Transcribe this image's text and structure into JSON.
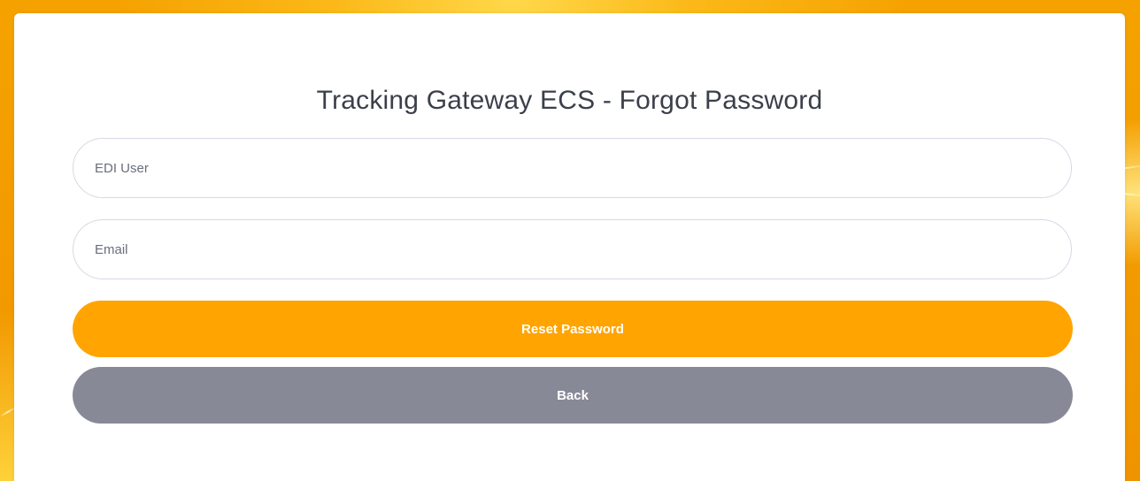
{
  "page": {
    "title": "Tracking Gateway ECS - Forgot Password"
  },
  "form": {
    "edi_user": {
      "value": "",
      "placeholder": "EDI User"
    },
    "email": {
      "value": "",
      "placeholder": "Email"
    },
    "reset_label": "Reset Password",
    "back_label": "Back"
  },
  "colors": {
    "background": "#f5a200",
    "card": "#ffffff",
    "primary_button": "#ffa400",
    "secondary_button": "#878997",
    "title_text": "#3b3f4a",
    "field_border": "#d7d8e6"
  }
}
